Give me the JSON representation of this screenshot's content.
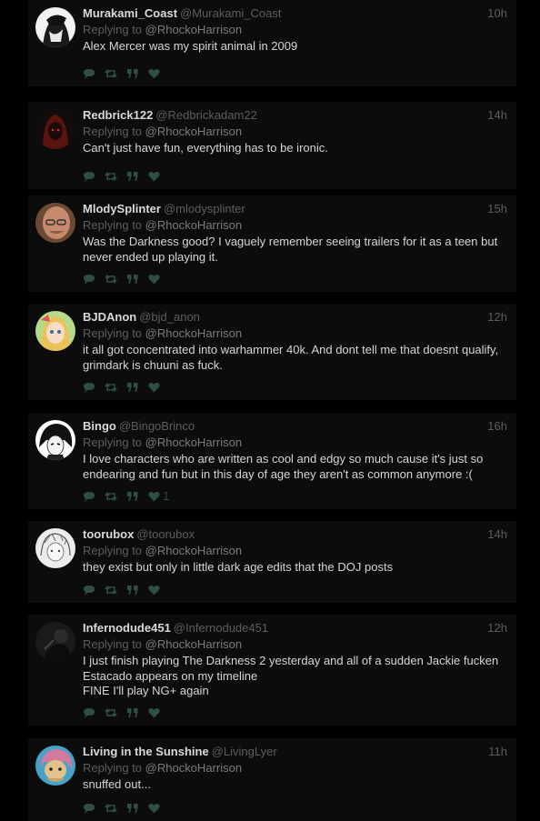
{
  "colors": {
    "background": "#000000",
    "card": "#0c0c0c",
    "name": "#d9d9d9",
    "muted": "#5d5d5d",
    "text": "#d6d6d6",
    "icon": "#2e4e46"
  },
  "reply_prefix": "Replying to",
  "tweets": [
    {
      "name": "Murakami_Coast",
      "handle": "@Murakami_Coast",
      "time": "10h",
      "reply_to": "@RhockoHarrison",
      "lines": [
        "Alex Mercer was my spirit animal in 2009"
      ],
      "likes": "",
      "avatar": "manga-portrait"
    },
    {
      "name": "Redbrick122",
      "handle": "@Redbrickadam22",
      "time": "14h",
      "reply_to": "@RhockoHarrison",
      "lines": [
        "Can't just have fun, everything has to be ironic."
      ],
      "likes": "",
      "avatar": "red-hood"
    },
    {
      "name": "MlodySplinter",
      "handle": "@mlodysplinter",
      "time": "15h",
      "reply_to": "@RhockoHarrison",
      "lines": [
        "Was the Darkness good? I vaguely remember seeing trailers for it as a teen but",
        "never ended up playing it."
      ],
      "likes": "",
      "avatar": "bald-man"
    },
    {
      "name": "BJDAnon",
      "handle": "@bjd_anon",
      "time": "12h",
      "reply_to": "@RhockoHarrison",
      "lines": [
        "it all got concentrated into warhammer 40k. And dont tell me that doesnt qualify,",
        "grimdark is chuuni as fuck."
      ],
      "likes": "",
      "avatar": "anime-girl"
    },
    {
      "name": "Bingo",
      "handle": "@BingoBrinco",
      "time": "16h",
      "reply_to": "@RhockoHarrison",
      "lines": [
        "I love characters who are written as cool and edgy so much cause it's just so",
        "endearing and fun but in this day of age they aren't as common anymore :("
      ],
      "likes": "1",
      "avatar": "manga-dark-hair"
    },
    {
      "name": "toorubox",
      "handle": "@toorubox",
      "time": "14h",
      "reply_to": "@RhockoHarrison",
      "lines": [
        "they exist but only in little dark age edits that the DOJ posts"
      ],
      "likes": "",
      "avatar": "sketch-character"
    },
    {
      "name": "Infernodude451",
      "handle": "@Infernodude451",
      "time": "12h",
      "reply_to": "@RhockoHarrison",
      "lines": [
        "I just finish playing The Darkness 2 yesterday and all of a sudden Jackie fucken",
        "Estacado appears on my timeline",
        "FINE I'll play NG+ again"
      ],
      "likes": "",
      "avatar": "dark-figure"
    },
    {
      "name": "Living in the Sunshine",
      "handle": "@LivingLyer",
      "time": "11h",
      "reply_to": "@RhockoHarrison",
      "lines": [
        "snuffed out..."
      ],
      "likes": "",
      "avatar": "pink-hair-character"
    }
  ]
}
